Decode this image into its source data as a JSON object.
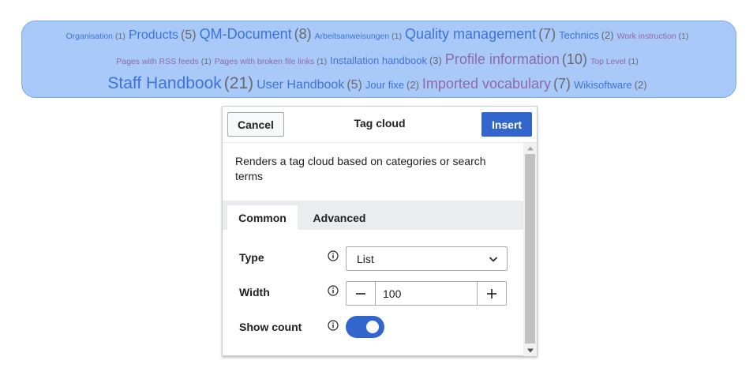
{
  "tag_cloud": {
    "rows": [
      [
        {
          "label": "Organisation",
          "count": "(1)",
          "size": "s1",
          "visited": false
        },
        {
          "label": "Products",
          "count": "(5)",
          "size": "s3",
          "visited": false
        },
        {
          "label": "QM-Document",
          "count": "(8)",
          "size": "s4",
          "visited": false
        },
        {
          "label": "Arbeitsanweisungen",
          "count": "(1)",
          "size": "s1",
          "visited": false
        },
        {
          "label": "Quality management",
          "count": "(7)",
          "size": "s4",
          "visited": false
        },
        {
          "label": "Technics",
          "count": "(2)",
          "size": "s2",
          "visited": false
        },
        {
          "label": "Work instruction",
          "count": "(1)",
          "size": "s1",
          "visited": true
        }
      ],
      [
        {
          "label": "Pages with RSS feeds",
          "count": "(1)",
          "size": "s1",
          "visited": true
        },
        {
          "label": "Pages with broken file links",
          "count": "(1)",
          "size": "s1",
          "visited": true
        },
        {
          "label": "Installation handbook",
          "count": "(3)",
          "size": "s2",
          "visited": false
        },
        {
          "label": "Profile information",
          "count": "(10)",
          "size": "s4",
          "visited": true
        },
        {
          "label": "Top Level",
          "count": "(1)",
          "size": "s1",
          "visited": true
        }
      ],
      [
        {
          "label": "Staff Handbook",
          "count": "(21)",
          "size": "s5",
          "visited": false
        },
        {
          "label": "User Handbook",
          "count": "(5)",
          "size": "s3",
          "visited": false
        },
        {
          "label": "Jour fixe",
          "count": "(2)",
          "size": "s2",
          "visited": false
        },
        {
          "label": "Imported vocabulary",
          "count": "(7)",
          "size": "s4",
          "visited": true
        },
        {
          "label": "Wikisoftware",
          "count": "(2)",
          "size": "s2",
          "visited": false
        }
      ]
    ]
  },
  "dialog": {
    "title": "Tag cloud",
    "cancel_label": "Cancel",
    "insert_label": "Insert",
    "description": "Renders a tag cloud based on categories or search terms",
    "tabs": [
      {
        "label": "Common",
        "active": true
      },
      {
        "label": "Advanced",
        "active": false
      }
    ],
    "fields": {
      "type": {
        "label": "Type",
        "value": "List"
      },
      "width": {
        "label": "Width",
        "value": "100"
      },
      "show_count": {
        "label": "Show count",
        "checked": true
      }
    }
  },
  "colors": {
    "cloud_bg": "#a9c9f8",
    "link": "#3f73d6",
    "visited_link": "#8e6aa8",
    "accent": "#3366cc"
  },
  "icons": [
    "info-icon",
    "chevron-down-icon",
    "minus-icon",
    "plus-icon",
    "scroll-up-arrow-icon",
    "scroll-down-arrow-icon"
  ]
}
